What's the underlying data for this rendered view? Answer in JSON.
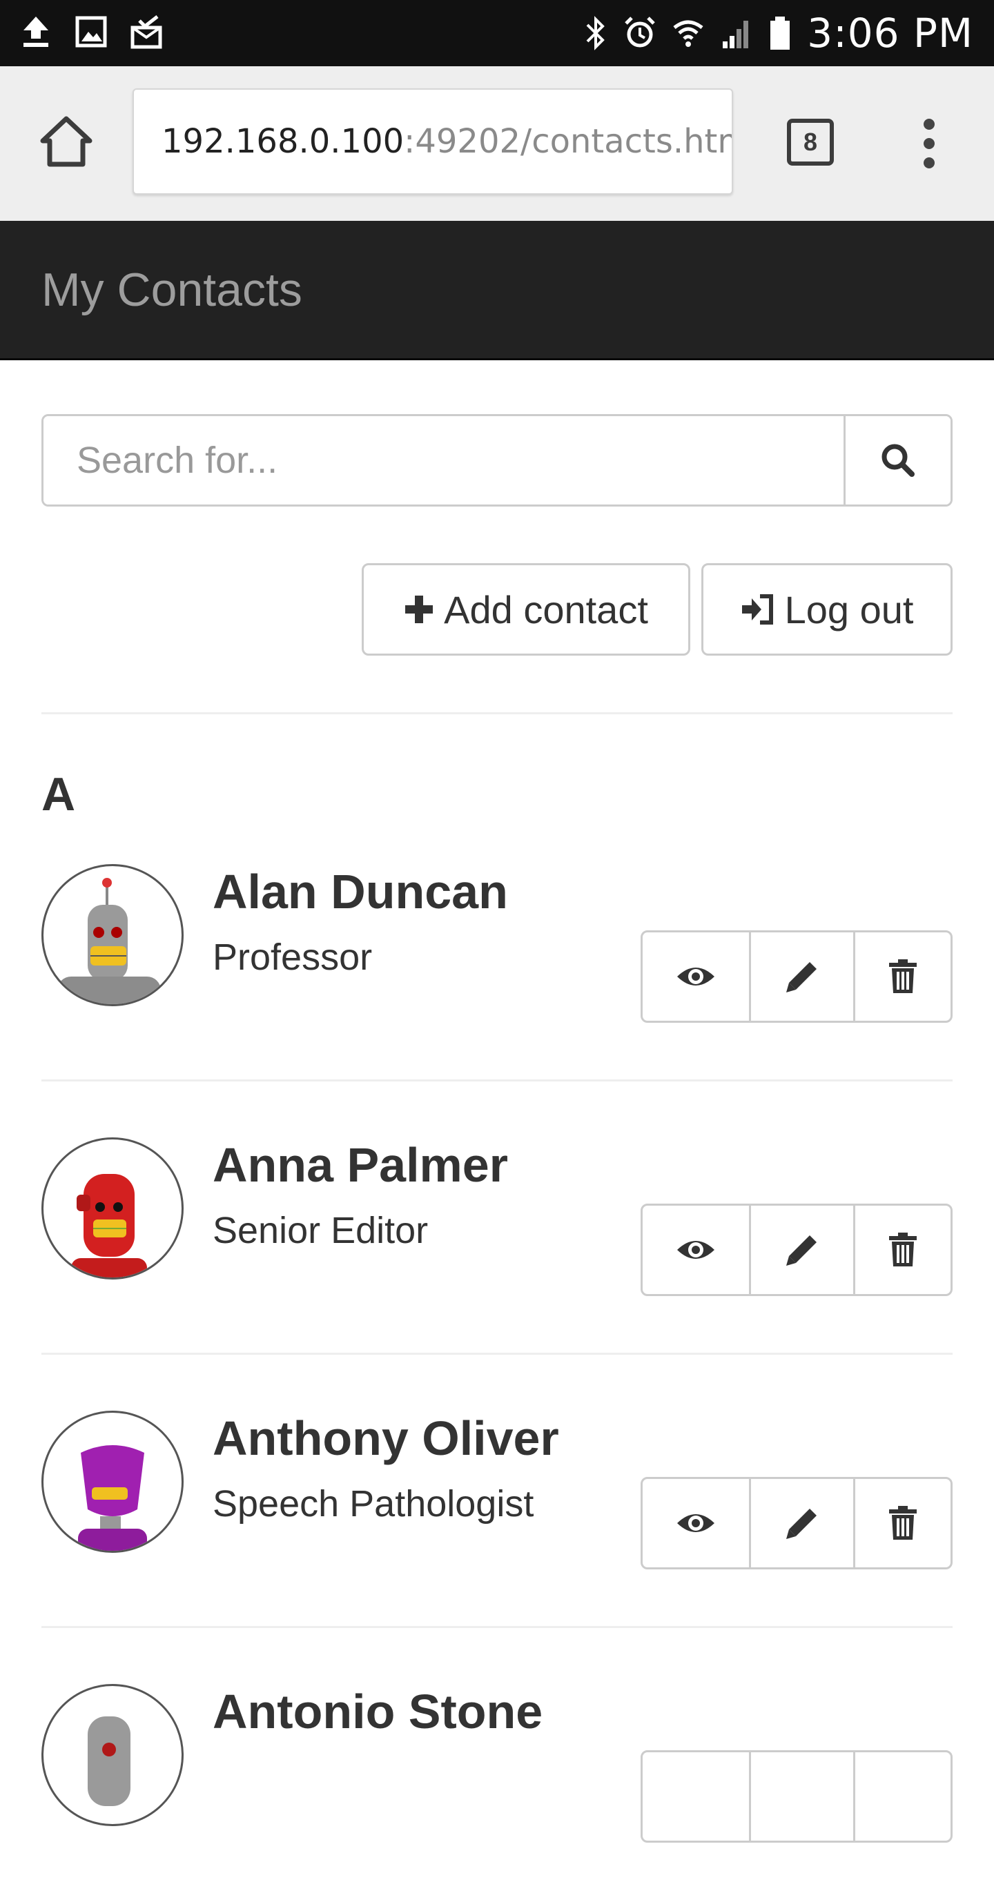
{
  "status_bar": {
    "time": "3:06 PM",
    "left_icons": [
      "upload-icon",
      "image-icon",
      "mail-check-icon"
    ],
    "right_icons": [
      "bluetooth-icon",
      "alarm-icon",
      "wifi-icon",
      "signal-icon",
      "battery-icon"
    ]
  },
  "browser": {
    "url_host": "192.168.0.100",
    "url_path": ":49202/contacts.htm",
    "tab_count": "8"
  },
  "navbar": {
    "brand": "My Contacts"
  },
  "search": {
    "placeholder": "Search for..."
  },
  "actions": {
    "add_label": "Add contact",
    "logout_label": "Log out"
  },
  "section_letter": "A",
  "contacts": [
    {
      "name": "Alan Duncan",
      "title": "Professor"
    },
    {
      "name": "Anna Palmer",
      "title": "Senior Editor"
    },
    {
      "name": "Anthony Oliver",
      "title": "Speech Pathologist"
    },
    {
      "name": "Antonio Stone",
      "title": ""
    }
  ],
  "colors": {
    "navbar_bg": "#222222",
    "brand_text": "#9d9d9d",
    "border": "#cccccc",
    "avatar_gray": "#9a9a9a",
    "avatar_red": "#d32020",
    "avatar_purple": "#a020b0"
  }
}
